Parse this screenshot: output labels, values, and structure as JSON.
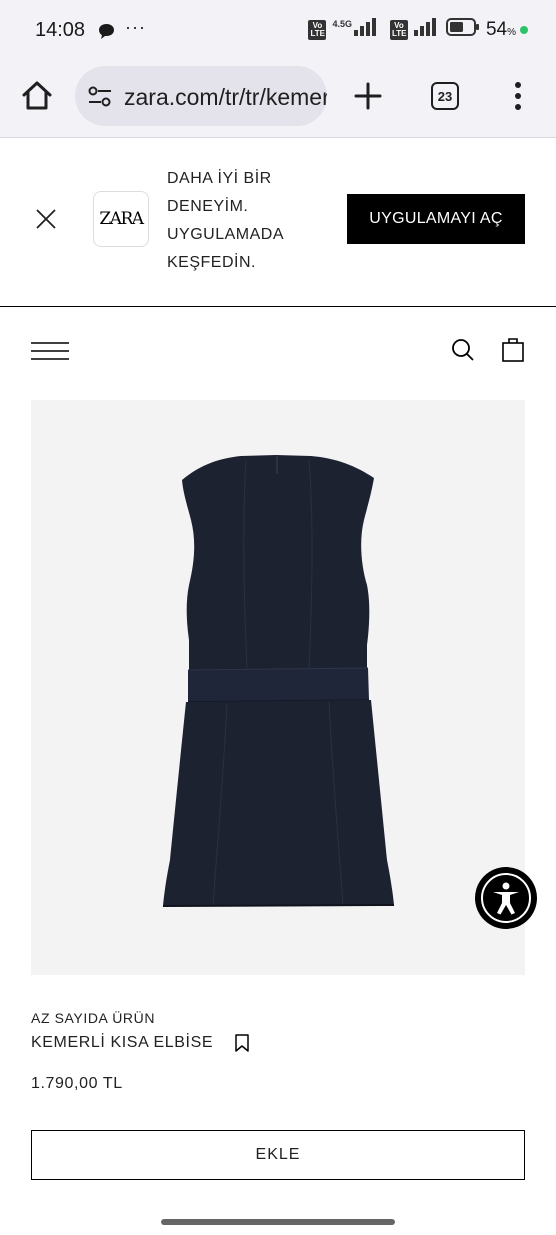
{
  "status_bar": {
    "time": "14:08",
    "network_type": "4.5G",
    "volte_label": "Vo LTE",
    "battery_percent": "54",
    "battery_percent_sign": "%",
    "icons": [
      "chat-bubble-icon",
      "more-dots-icon",
      "volte-icon",
      "signal-icon",
      "battery-icon",
      "charging-dot-icon"
    ],
    "dots": "···"
  },
  "browser": {
    "url": "zara.com/tr/tr/kemerli-kisa-elbise",
    "tab_count": "23",
    "icons": [
      "home-icon",
      "site-settings-icon",
      "new-tab-plus-icon",
      "tab-switcher-icon",
      "overflow-menu-icon"
    ]
  },
  "app_banner": {
    "logo_text": "ZARA",
    "message": "DAHA İYİ BİR DENEYİM. UYGULAMADA KEŞFEDİN.",
    "button_label": "UYGULAMAYI AÇ"
  },
  "header": {
    "icons": [
      "hamburger-menu-icon",
      "search-icon",
      "shopping-bag-icon"
    ]
  },
  "product": {
    "status": "AZ SAYIDA ÜRÜN",
    "name": "KEMERLİ KISA ELBİSE",
    "price": "1.790,00 TL",
    "add_button": "EKLE",
    "image_colors": {
      "background": "#f3f3f3",
      "dress": "#1d2230"
    }
  },
  "accessibility": {
    "icon": "accessibility-icon"
  }
}
